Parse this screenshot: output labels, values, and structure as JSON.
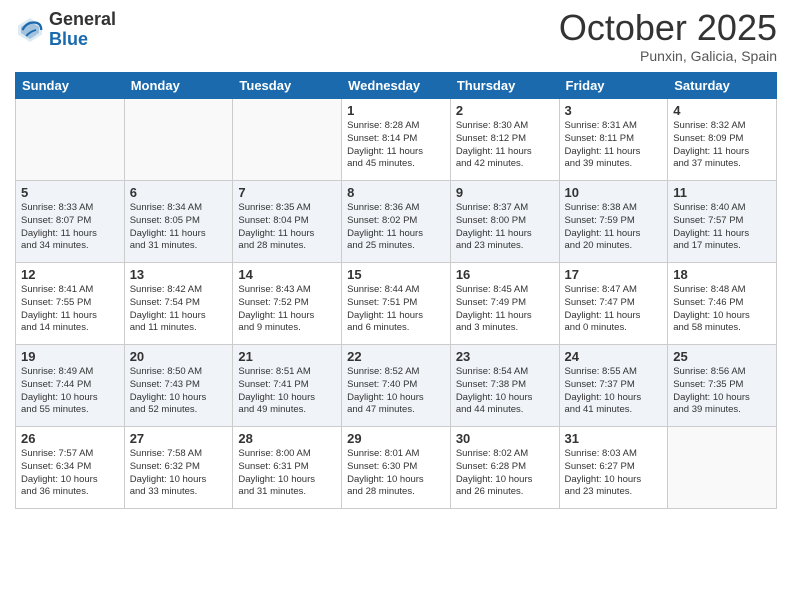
{
  "logo": {
    "general": "General",
    "blue": "Blue"
  },
  "title": "October 2025",
  "location": "Punxin, Galicia, Spain",
  "days_of_week": [
    "Sunday",
    "Monday",
    "Tuesday",
    "Wednesday",
    "Thursday",
    "Friday",
    "Saturday"
  ],
  "weeks": [
    {
      "alt": false,
      "days": [
        {
          "num": "",
          "info": ""
        },
        {
          "num": "",
          "info": ""
        },
        {
          "num": "",
          "info": ""
        },
        {
          "num": "1",
          "info": "Sunrise: 8:28 AM\nSunset: 8:14 PM\nDaylight: 11 hours\nand 45 minutes."
        },
        {
          "num": "2",
          "info": "Sunrise: 8:30 AM\nSunset: 8:12 PM\nDaylight: 11 hours\nand 42 minutes."
        },
        {
          "num": "3",
          "info": "Sunrise: 8:31 AM\nSunset: 8:11 PM\nDaylight: 11 hours\nand 39 minutes."
        },
        {
          "num": "4",
          "info": "Sunrise: 8:32 AM\nSunset: 8:09 PM\nDaylight: 11 hours\nand 37 minutes."
        }
      ]
    },
    {
      "alt": true,
      "days": [
        {
          "num": "5",
          "info": "Sunrise: 8:33 AM\nSunset: 8:07 PM\nDaylight: 11 hours\nand 34 minutes."
        },
        {
          "num": "6",
          "info": "Sunrise: 8:34 AM\nSunset: 8:05 PM\nDaylight: 11 hours\nand 31 minutes."
        },
        {
          "num": "7",
          "info": "Sunrise: 8:35 AM\nSunset: 8:04 PM\nDaylight: 11 hours\nand 28 minutes."
        },
        {
          "num": "8",
          "info": "Sunrise: 8:36 AM\nSunset: 8:02 PM\nDaylight: 11 hours\nand 25 minutes."
        },
        {
          "num": "9",
          "info": "Sunrise: 8:37 AM\nSunset: 8:00 PM\nDaylight: 11 hours\nand 23 minutes."
        },
        {
          "num": "10",
          "info": "Sunrise: 8:38 AM\nSunset: 7:59 PM\nDaylight: 11 hours\nand 20 minutes."
        },
        {
          "num": "11",
          "info": "Sunrise: 8:40 AM\nSunset: 7:57 PM\nDaylight: 11 hours\nand 17 minutes."
        }
      ]
    },
    {
      "alt": false,
      "days": [
        {
          "num": "12",
          "info": "Sunrise: 8:41 AM\nSunset: 7:55 PM\nDaylight: 11 hours\nand 14 minutes."
        },
        {
          "num": "13",
          "info": "Sunrise: 8:42 AM\nSunset: 7:54 PM\nDaylight: 11 hours\nand 11 minutes."
        },
        {
          "num": "14",
          "info": "Sunrise: 8:43 AM\nSunset: 7:52 PM\nDaylight: 11 hours\nand 9 minutes."
        },
        {
          "num": "15",
          "info": "Sunrise: 8:44 AM\nSunset: 7:51 PM\nDaylight: 11 hours\nand 6 minutes."
        },
        {
          "num": "16",
          "info": "Sunrise: 8:45 AM\nSunset: 7:49 PM\nDaylight: 11 hours\nand 3 minutes."
        },
        {
          "num": "17",
          "info": "Sunrise: 8:47 AM\nSunset: 7:47 PM\nDaylight: 11 hours\nand 0 minutes."
        },
        {
          "num": "18",
          "info": "Sunrise: 8:48 AM\nSunset: 7:46 PM\nDaylight: 10 hours\nand 58 minutes."
        }
      ]
    },
    {
      "alt": true,
      "days": [
        {
          "num": "19",
          "info": "Sunrise: 8:49 AM\nSunset: 7:44 PM\nDaylight: 10 hours\nand 55 minutes."
        },
        {
          "num": "20",
          "info": "Sunrise: 8:50 AM\nSunset: 7:43 PM\nDaylight: 10 hours\nand 52 minutes."
        },
        {
          "num": "21",
          "info": "Sunrise: 8:51 AM\nSunset: 7:41 PM\nDaylight: 10 hours\nand 49 minutes."
        },
        {
          "num": "22",
          "info": "Sunrise: 8:52 AM\nSunset: 7:40 PM\nDaylight: 10 hours\nand 47 minutes."
        },
        {
          "num": "23",
          "info": "Sunrise: 8:54 AM\nSunset: 7:38 PM\nDaylight: 10 hours\nand 44 minutes."
        },
        {
          "num": "24",
          "info": "Sunrise: 8:55 AM\nSunset: 7:37 PM\nDaylight: 10 hours\nand 41 minutes."
        },
        {
          "num": "25",
          "info": "Sunrise: 8:56 AM\nSunset: 7:35 PM\nDaylight: 10 hours\nand 39 minutes."
        }
      ]
    },
    {
      "alt": false,
      "days": [
        {
          "num": "26",
          "info": "Sunrise: 7:57 AM\nSunset: 6:34 PM\nDaylight: 10 hours\nand 36 minutes."
        },
        {
          "num": "27",
          "info": "Sunrise: 7:58 AM\nSunset: 6:32 PM\nDaylight: 10 hours\nand 33 minutes."
        },
        {
          "num": "28",
          "info": "Sunrise: 8:00 AM\nSunset: 6:31 PM\nDaylight: 10 hours\nand 31 minutes."
        },
        {
          "num": "29",
          "info": "Sunrise: 8:01 AM\nSunset: 6:30 PM\nDaylight: 10 hours\nand 28 minutes."
        },
        {
          "num": "30",
          "info": "Sunrise: 8:02 AM\nSunset: 6:28 PM\nDaylight: 10 hours\nand 26 minutes."
        },
        {
          "num": "31",
          "info": "Sunrise: 8:03 AM\nSunset: 6:27 PM\nDaylight: 10 hours\nand 23 minutes."
        },
        {
          "num": "",
          "info": ""
        }
      ]
    }
  ]
}
